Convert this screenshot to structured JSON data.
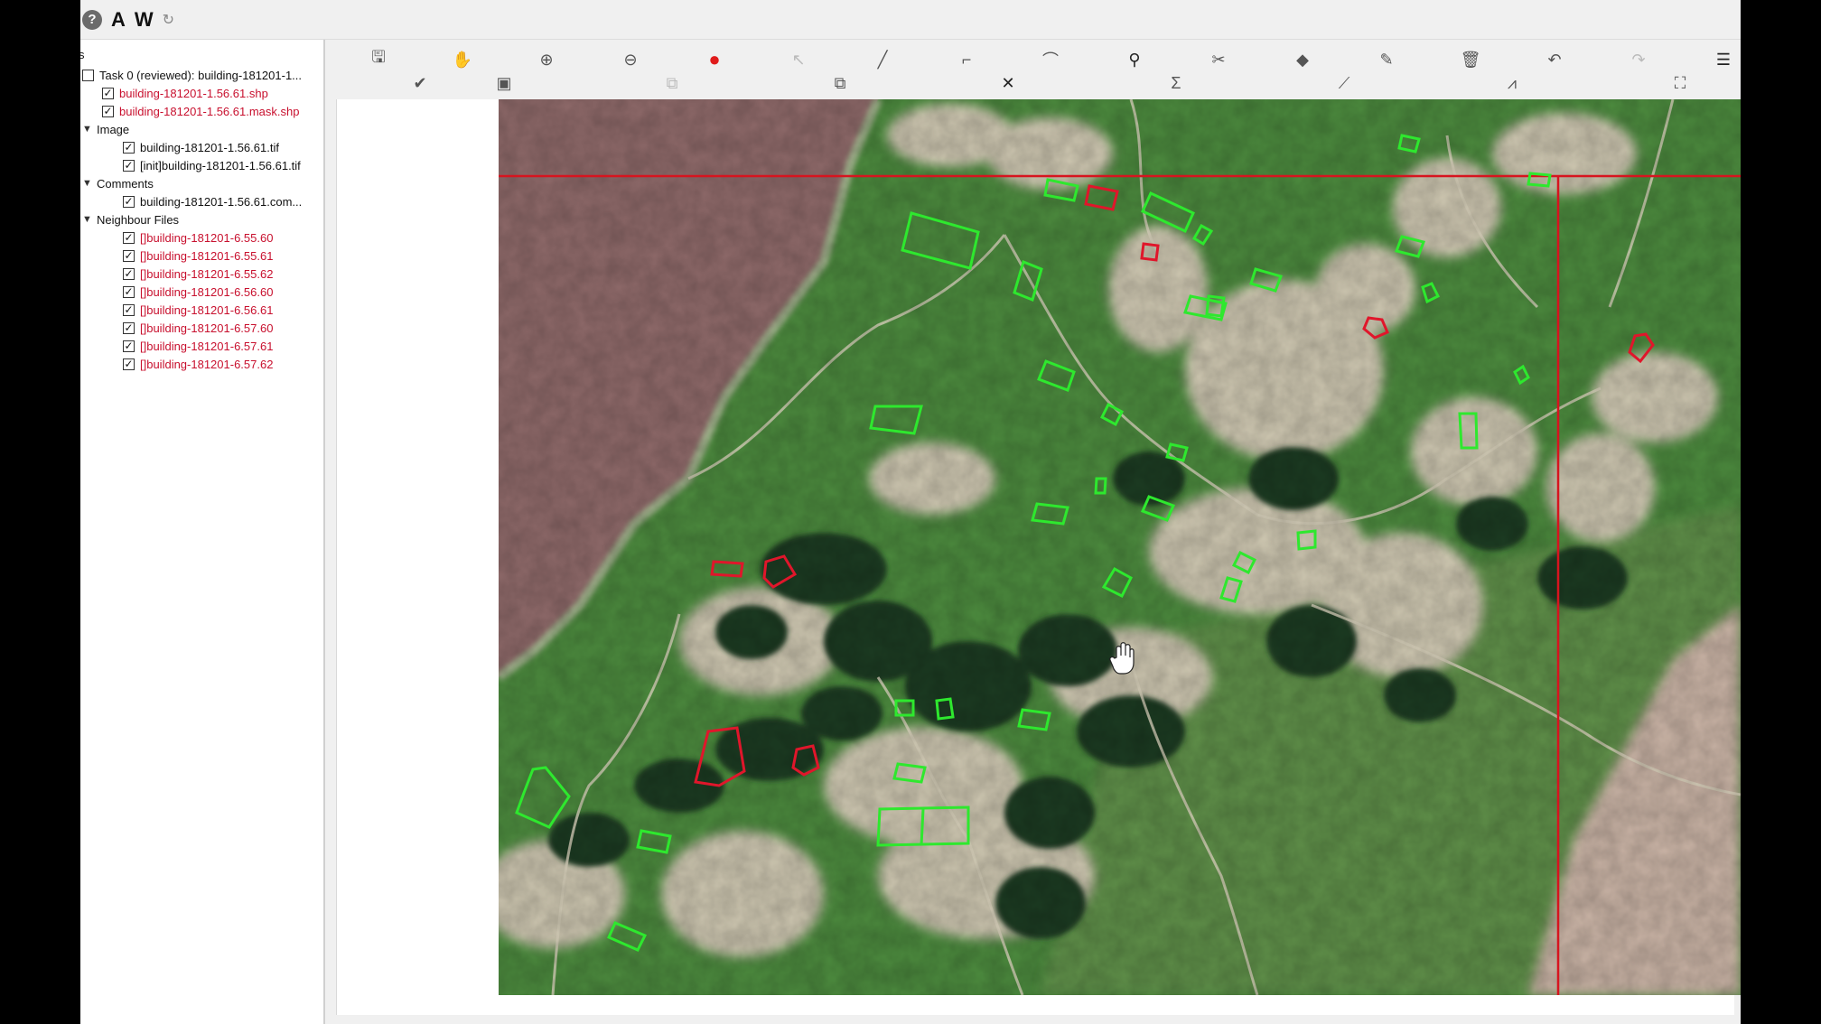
{
  "top_bar": {
    "letters": [
      "A",
      "W"
    ],
    "icons": [
      "info-circle-icon",
      "refresh-icon"
    ]
  },
  "layer_tree": {
    "header_fragment": "s",
    "task": {
      "label": "Task 0 (reviewed): building-181201-1...",
      "checked": false
    },
    "task_files": [
      {
        "label": "building-181201-1.56.61.shp",
        "checked": true,
        "color": "#c8102e"
      },
      {
        "label": "building-181201-1.56.61.mask.shp",
        "checked": true,
        "color": "#c8102e"
      }
    ],
    "groups": {
      "image": {
        "label": "Image",
        "items": [
          {
            "label": "building-181201-1.56.61.tif",
            "checked": true
          },
          {
            "label": "[init]building-181201-1.56.61.tif",
            "checked": true
          }
        ]
      },
      "comments": {
        "label": "Comments",
        "items": [
          {
            "label": "building-181201-1.56.61.com...",
            "checked": true
          }
        ]
      },
      "neighbour": {
        "label": "Neighbour Files",
        "items": [
          {
            "label": "[]building-181201-6.55.60",
            "checked": true
          },
          {
            "label": "[]building-181201-6.55.61",
            "checked": true
          },
          {
            "label": "[]building-181201-6.55.62",
            "checked": true
          },
          {
            "label": "[]building-181201-6.56.60",
            "checked": true
          },
          {
            "label": "[]building-181201-6.56.61",
            "checked": true
          },
          {
            "label": "[]building-181201-6.57.60",
            "checked": true
          },
          {
            "label": "[]building-181201-6.57.61",
            "checked": true
          },
          {
            "label": "[]building-181201-6.57.62",
            "checked": true
          }
        ]
      }
    }
  },
  "toolbar": {
    "row1": [
      "save-icon",
      "pan-hand-icon",
      "zoom-in-icon",
      "zoom-out-icon",
      "record-icon",
      "select-pointer-icon",
      "draw-line-icon",
      "draw-corner-icon",
      "draw-curve-icon",
      "location-pin-icon",
      "split-icon",
      "fill-icon",
      "edit-icon",
      "delete-icon",
      "undo-icon",
      "redo-icon",
      "menu-icon"
    ],
    "row2": [
      "check-circle-icon",
      "screenshot-icon",
      "copy-disabled-icon",
      "layers-icon",
      "cross-icon",
      "sigma-icon",
      "chart-line-icon",
      "chart-zigzag-icon",
      "fit-frame-icon"
    ]
  },
  "map": {
    "colors": {
      "accepted": "#2ee82e",
      "rejected": "#e0162b",
      "tile_boundary": "#d7141f",
      "water": "#8f6a6a",
      "vegetation": "#4c8a3e",
      "bare_soil": "#cdc6b0"
    },
    "cursor_icon": "hand-cursor-icon"
  }
}
